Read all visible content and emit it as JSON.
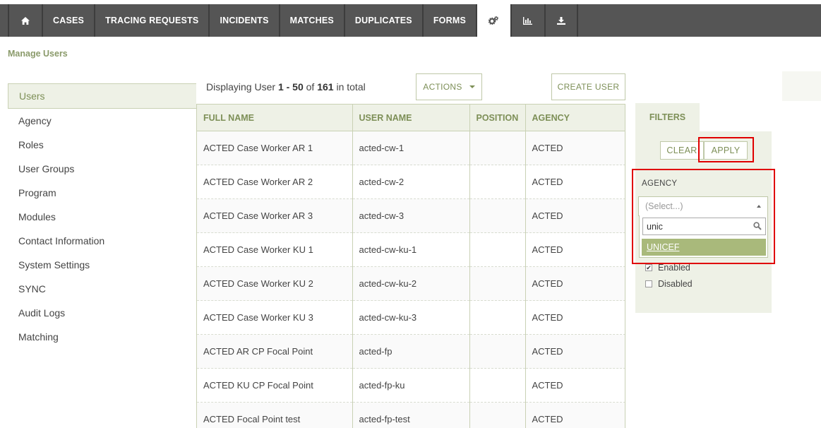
{
  "nav": {
    "items": [
      {
        "label": "",
        "icon": "home-icon"
      },
      {
        "label": "CASES"
      },
      {
        "label": "TRACING REQUESTS"
      },
      {
        "label": "INCIDENTS"
      },
      {
        "label": "MATCHES"
      },
      {
        "label": "DUPLICATES"
      },
      {
        "label": "FORMS"
      },
      {
        "label": "",
        "icon": "gears-icon",
        "active": true
      },
      {
        "label": "",
        "icon": "bar-chart-icon"
      },
      {
        "label": "",
        "icon": "download-icon"
      }
    ]
  },
  "breadcrumb": "Manage Users",
  "sidebar": {
    "items": [
      {
        "label": "Users",
        "active": true
      },
      {
        "label": "Agency"
      },
      {
        "label": "Roles"
      },
      {
        "label": "User Groups"
      },
      {
        "label": "Program"
      },
      {
        "label": "Modules"
      },
      {
        "label": "Contact Information"
      },
      {
        "label": "System Settings"
      },
      {
        "label": "SYNC"
      },
      {
        "label": "Audit Logs"
      },
      {
        "label": "Matching"
      }
    ]
  },
  "toolbar": {
    "display_prefix": "Displaying User ",
    "range": "1 - 50",
    "of": " of ",
    "total": "161",
    "suffix": " in total",
    "actions_label": "ACTIONS",
    "create_label": "CREATE USER"
  },
  "table": {
    "headers": [
      "FULL NAME",
      "USER NAME",
      "POSITION",
      "AGENCY"
    ],
    "rows": [
      [
        "ACTED Case Worker AR 1",
        "acted-cw-1",
        "",
        "ACTED"
      ],
      [
        "ACTED Case Worker AR 2",
        "acted-cw-2",
        "",
        "ACTED"
      ],
      [
        "ACTED Case Worker AR 3",
        "acted-cw-3",
        "",
        "ACTED"
      ],
      [
        "ACTED Case Worker KU 1",
        "acted-cw-ku-1",
        "",
        "ACTED"
      ],
      [
        "ACTED Case Worker KU 2",
        "acted-cw-ku-2",
        "",
        "ACTED"
      ],
      [
        "ACTED Case Worker KU 3",
        "acted-cw-ku-3",
        "",
        "ACTED"
      ],
      [
        "ACTED AR CP Focal Point",
        "acted-fp",
        "",
        "ACTED"
      ],
      [
        "ACTED KU CP Focal Point",
        "acted-fp-ku",
        "",
        "ACTED"
      ],
      [
        "ACTED Focal Point test",
        "acted-fp-test",
        "",
        "ACTED"
      ]
    ]
  },
  "filters": {
    "tab_label": "FILTERS",
    "clear_label": "CLEAR",
    "apply_label": "APPLY",
    "agency_label": "AGENCY",
    "select_placeholder": "(Select...)",
    "search_value": "unic",
    "option_label": "UNICEF",
    "status_options": [
      {
        "label": "Enabled",
        "checked": true
      },
      {
        "label": "Disabled",
        "checked": false
      }
    ]
  },
  "colors": {
    "nav_bg": "#555555",
    "accent": "#7d8f57",
    "highlight_option": "#a9b97b",
    "panel_bg": "#eef1e6",
    "annotation_red": "#e00000"
  }
}
